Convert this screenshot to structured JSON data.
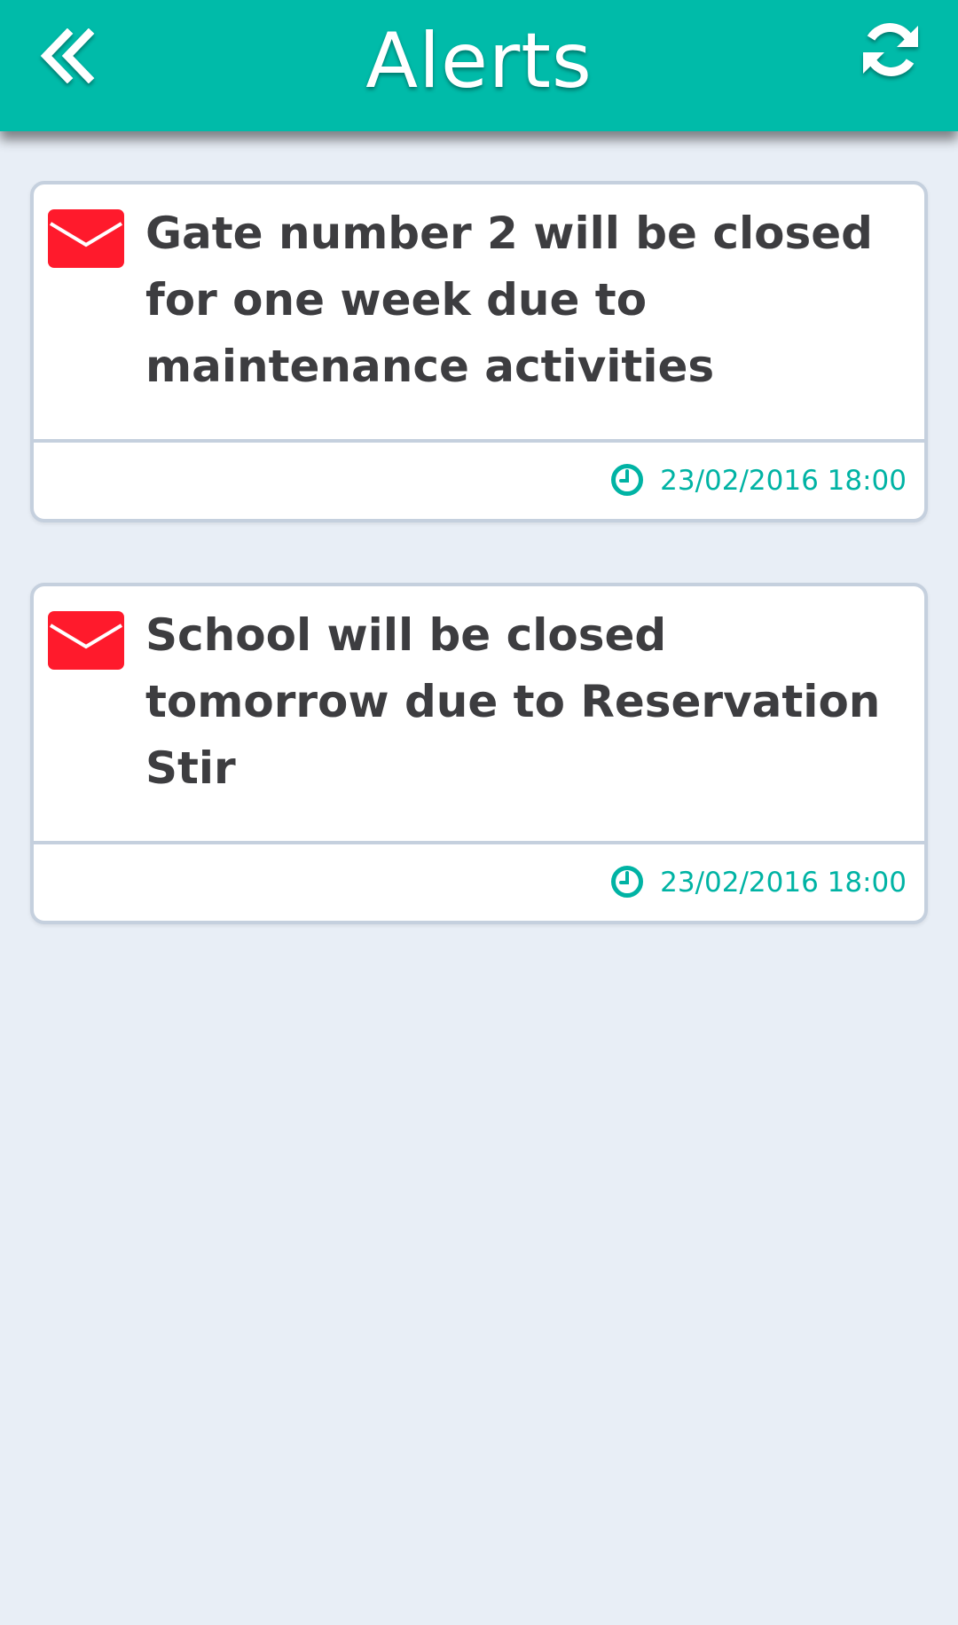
{
  "header": {
    "title": "Alerts",
    "back_icon": "double-chevron-left-icon",
    "refresh_icon": "refresh-icon"
  },
  "colors": {
    "accent": "#00bba9",
    "background": "#e8eef6",
    "mail_icon": "#ff1a2c",
    "timestamp": "#00b3a4",
    "card_border": "#c5d0de",
    "text": "#3d3d40"
  },
  "alerts": [
    {
      "icon": "mail-icon",
      "message": "Gate number 2 will be closed for one week due to maintenance activities",
      "time_icon": "clock-icon",
      "timestamp": "23/02/2016 18:00"
    },
    {
      "icon": "mail-icon",
      "message": "School will be closed tomorrow due to Reservation Stir",
      "time_icon": "clock-icon",
      "timestamp": "23/02/2016 18:00"
    }
  ]
}
